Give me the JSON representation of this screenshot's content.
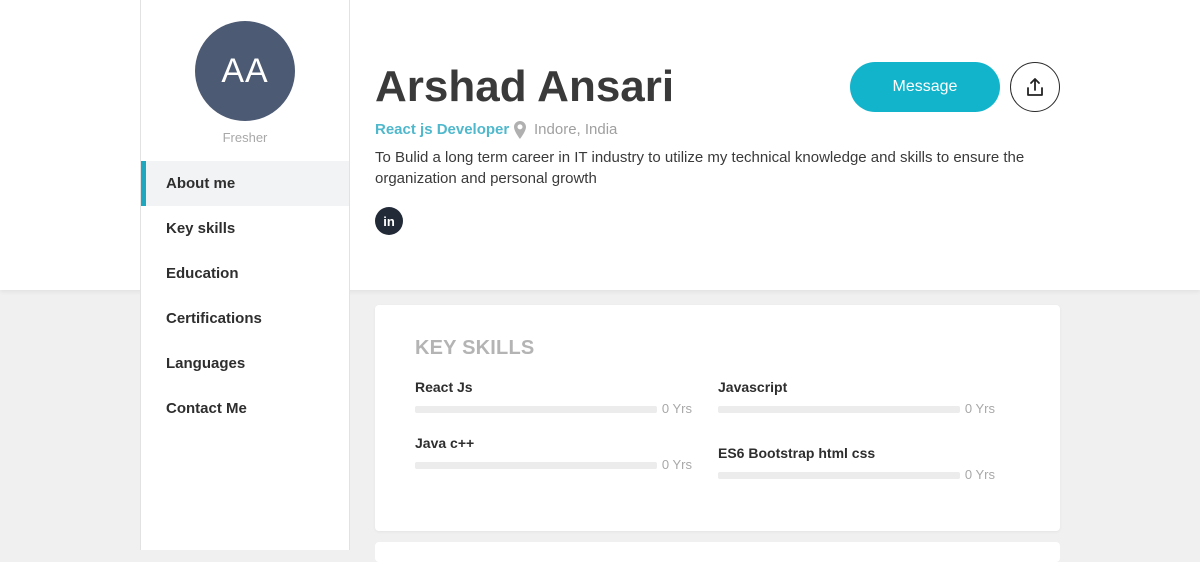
{
  "profile": {
    "initials": "AA",
    "status": "Fresher",
    "name": "Arshad Ansari",
    "role": "React js Developer",
    "location": "Indore, India",
    "bio": "To Bulid a long term career in IT industry to utilize my technical knowledge and skills to ensure the organization and personal growth",
    "linkedin_icon": "linkedin-icon"
  },
  "actions": {
    "message_label": "Message",
    "share_icon": "share-icon"
  },
  "nav": {
    "items": [
      {
        "label": "About me",
        "active": true
      },
      {
        "label": "Key skills",
        "active": false
      },
      {
        "label": "Education",
        "active": false
      },
      {
        "label": "Certifications",
        "active": false
      },
      {
        "label": "Languages",
        "active": false
      },
      {
        "label": "Contact Me",
        "active": false
      }
    ]
  },
  "key_skills": {
    "title": "KEY SKILLS",
    "skills": [
      {
        "name": "React Js",
        "years": "0 Yrs",
        "level": 0
      },
      {
        "name": "Javascript",
        "years": "0 Yrs",
        "level": 0
      },
      {
        "name": "Java c++",
        "years": "0 Yrs",
        "level": 0
      },
      {
        "name": "ES6 Bootstrap html css",
        "years": "0 Yrs",
        "level": 0
      }
    ]
  },
  "colors": {
    "accent": "#12b4cc",
    "role_text": "#4fb8cc",
    "avatar_bg": "#4d5a73",
    "nav_active_border": "#1fa7bf",
    "linkedin_bg": "#222a38"
  }
}
